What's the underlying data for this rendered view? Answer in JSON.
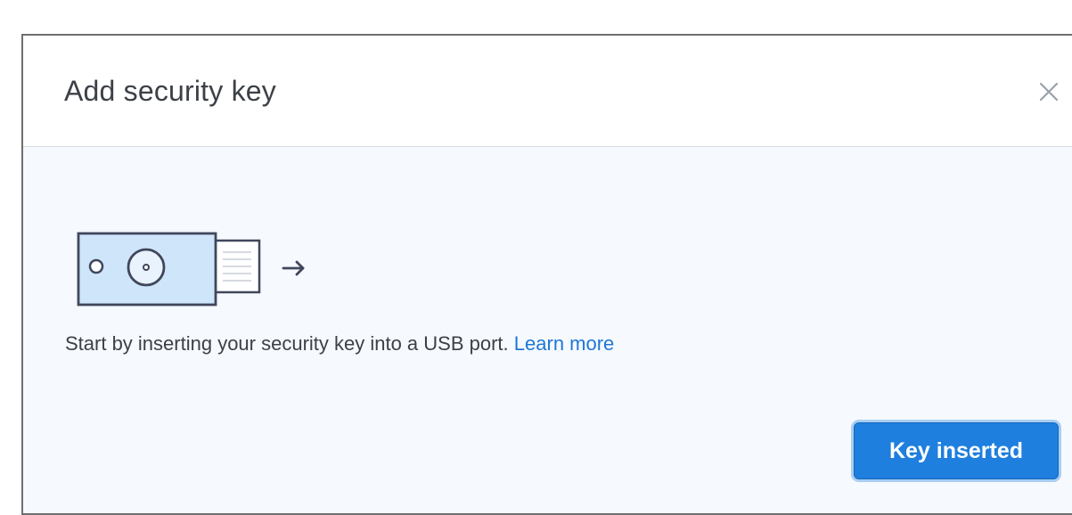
{
  "dialog": {
    "title": "Add security key",
    "close_icon": "close-icon",
    "body_text": "Start by inserting your security key into a USB port.",
    "learn_more_label": "Learn more",
    "primary_button_label": "Key inserted",
    "illustration_icon": "usb-security-key-icon",
    "arrow_icon": "arrow-right-icon"
  },
  "colors": {
    "accent": "#1e7fde",
    "link": "#1f77d6",
    "body_background": "#f6f9fd",
    "text": "#3c4147"
  }
}
